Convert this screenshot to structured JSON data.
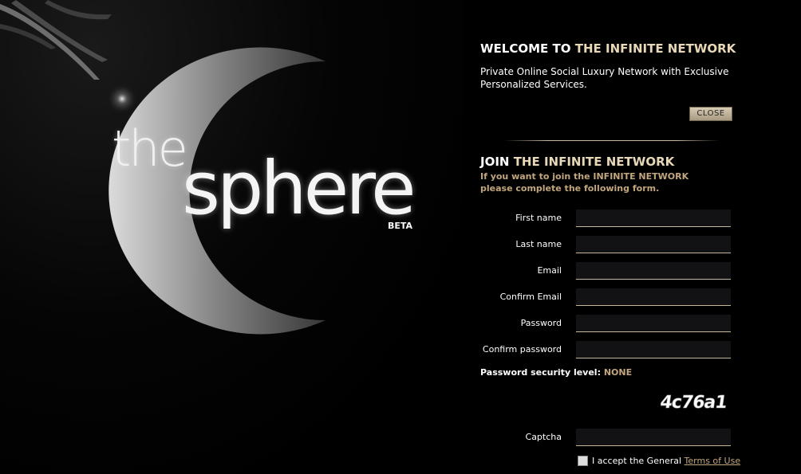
{
  "branding": {
    "logo_the": "the",
    "logo_sphere": "sphere",
    "logo_beta": "BETA"
  },
  "welcome": {
    "title_prefix": "WELCOME TO",
    "title_highlight": "THE INFINITE NETWORK",
    "description": "Private Online Social Luxury Network with Exclusive Personalized Services.",
    "close_label": "CLOSE"
  },
  "join": {
    "title_prefix": "JOIN",
    "title_highlight": "THE INFINITE NETWORK",
    "description": "If you want to join the INFINITE NETWORK please complete the following form."
  },
  "form": {
    "fields": [
      {
        "label": "First name",
        "value": ""
      },
      {
        "label": "Last name",
        "value": ""
      },
      {
        "label": "Email",
        "value": ""
      },
      {
        "label": "Confirm Email",
        "value": ""
      },
      {
        "label": "Password",
        "value": ""
      },
      {
        "label": "Confirm password",
        "value": ""
      }
    ],
    "password_level_label": "Password security level:",
    "password_level_value": "NONE",
    "captcha_text": "4c76a1",
    "captcha_label": "Captcha",
    "captcha_value": "",
    "accept_text": "I accept the General",
    "terms_link": "Terms of Use"
  }
}
